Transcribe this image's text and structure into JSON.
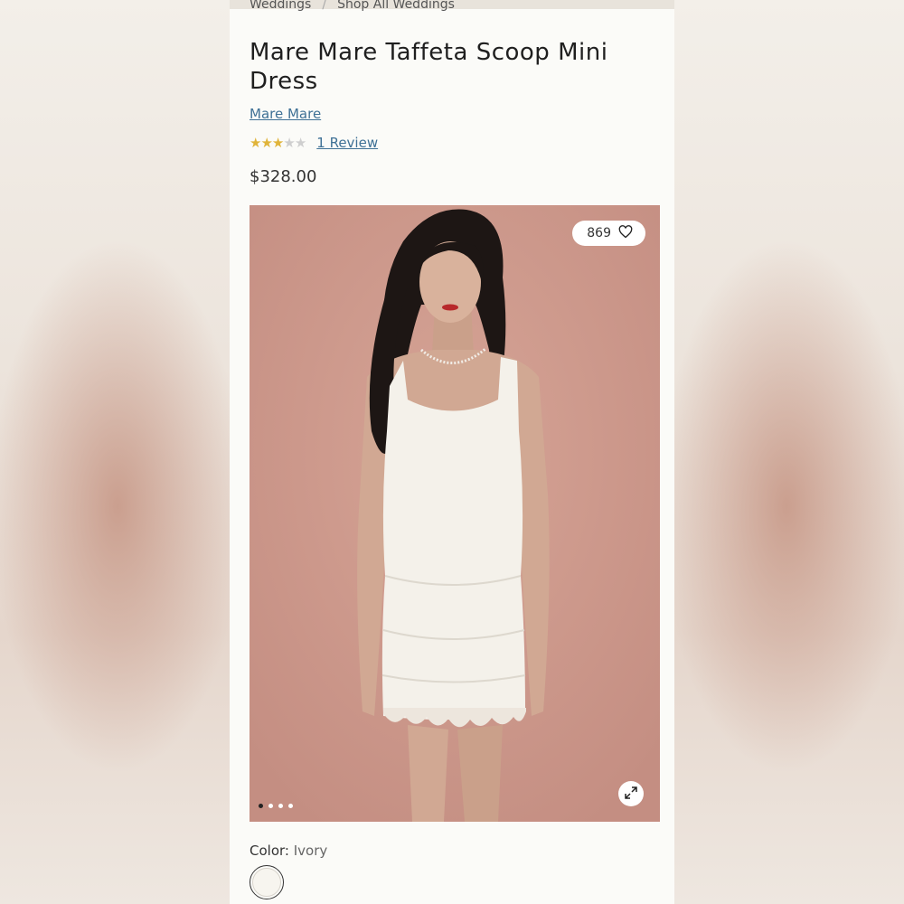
{
  "breadcrumb": {
    "items": [
      "Weddings",
      "Shop All Weddings"
    ],
    "separator": "/"
  },
  "product": {
    "title": "Mare Mare Taffeta Scoop Mini Dress",
    "brand": "Mare Mare",
    "rating": {
      "value": 3,
      "max": 5,
      "review_label": "1 Review"
    },
    "price": "$328.00"
  },
  "gallery": {
    "like_count": "869",
    "like_icon": "heart-icon",
    "expand_icon": "expand-icon",
    "image_count": 4,
    "active_index": 0
  },
  "options": {
    "color_label": "Color:",
    "color_value": "Ivory",
    "swatch_color": "#f7f5ef"
  },
  "colors": {
    "link": "#3f7196",
    "star": "#e0b43a",
    "photo_bg": "#cf9a8e"
  }
}
